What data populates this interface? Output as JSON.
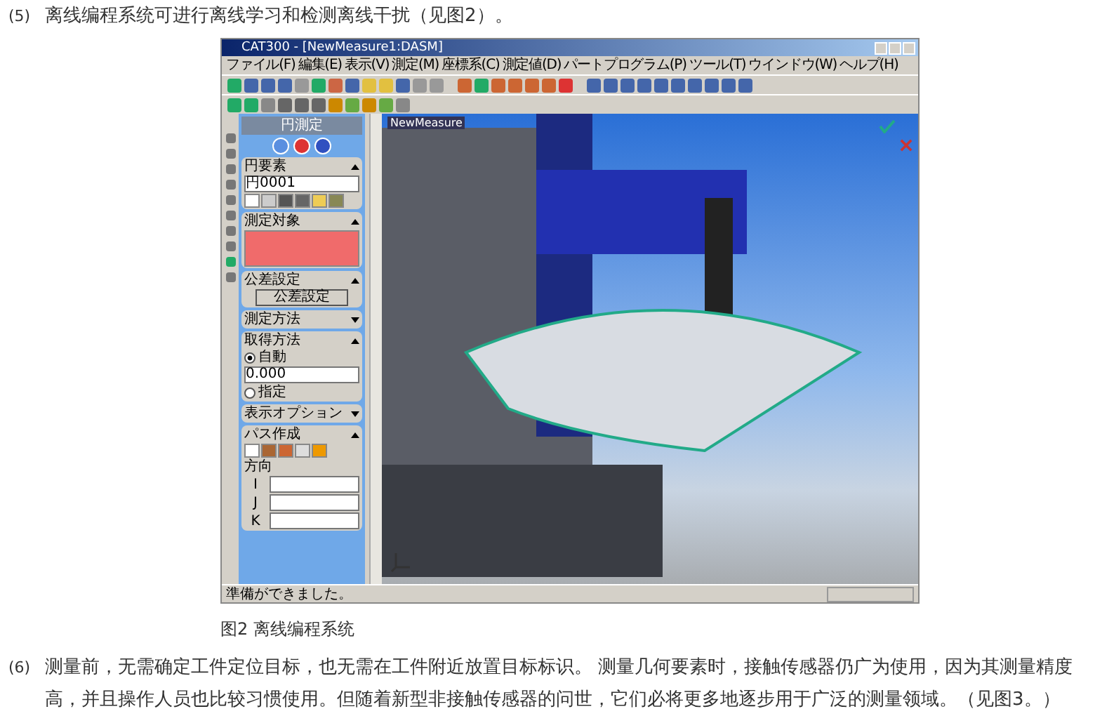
{
  "intro": {
    "number": "(5)",
    "text": "离线编程系统可进行离线学习和检测离线干扰（见图2）。"
  },
  "app": {
    "title": "CAT300 - [NewMeasure1:DASM]",
    "menu": [
      "ファイル(F)",
      "編集(E)",
      "表示(V)",
      "測定(M)",
      "座標系(C)",
      "測定値(D)",
      "パートプログラム(P)",
      "ツール(T)",
      "ウインドウ(W)",
      "ヘルプ(H)"
    ],
    "panel": {
      "title": "円測定",
      "sections": [
        {
          "kind": "element",
          "title": "円要素",
          "expanded": true,
          "field": "円0001"
        },
        {
          "kind": "target",
          "title": "測定対象",
          "expanded": true
        },
        {
          "kind": "button",
          "title": "公差設定",
          "expanded": true,
          "button": "公差設定"
        },
        {
          "title": "測定方法",
          "expanded": false
        },
        {
          "kind": "options",
          "title": "取得方法",
          "expanded": true,
          "options": [
            {
              "kind": "radio",
              "label": "自動",
              "selected": true
            },
            {
              "kind": "field",
              "value": "0.000"
            },
            {
              "kind": "radio",
              "label": "指定",
              "selected": false
            }
          ]
        },
        {
          "title": "表示オプション",
          "expanded": false
        },
        {
          "kind": "path",
          "title": "パス作成",
          "expanded": true,
          "label": "方向",
          "rows": [
            "I",
            "J",
            "K"
          ]
        }
      ]
    },
    "viewport": {
      "tab": "NewMeasure"
    },
    "status": "準備ができました。"
  },
  "caption": "图2 离线编程系统",
  "outro": {
    "number": "(6)",
    "text": "测量前，无需确定工件定位目标，也无需在工件附近放置目标标识。 测量几何要素时，接触传感器仍广为使用，因为其测量精度高，并且操作人员也比较习惯使用。但随着新型非接触传感器的问世，它们必将更多地逐步用于广泛的测量领域。（见图3。）"
  }
}
